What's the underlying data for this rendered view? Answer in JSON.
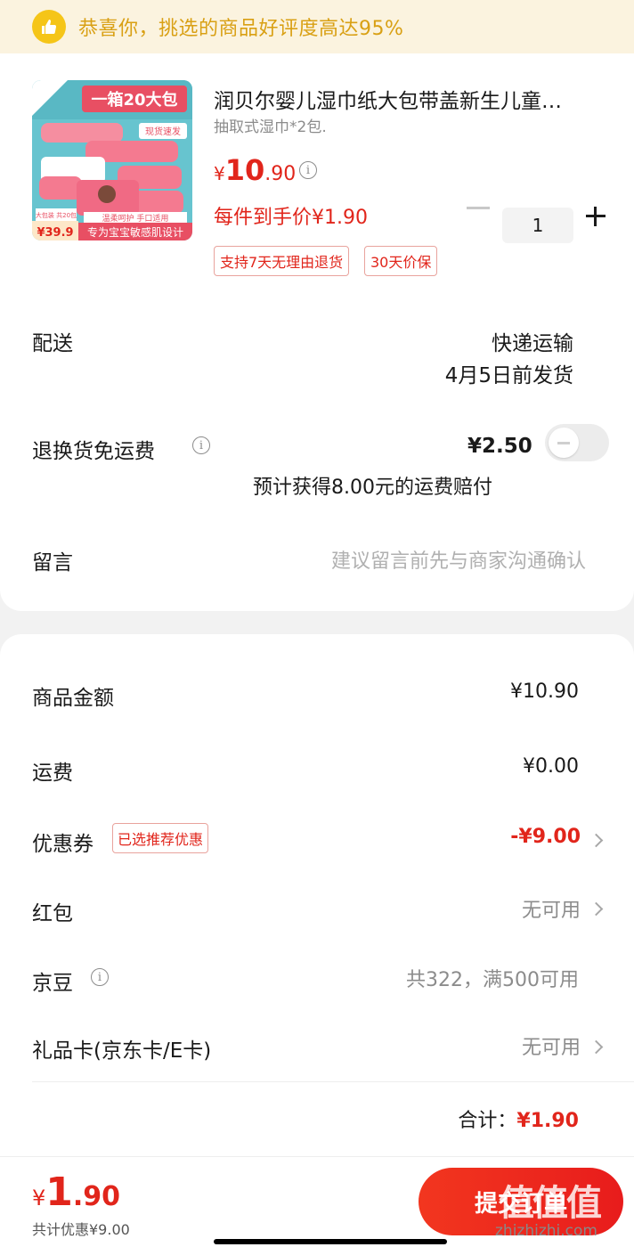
{
  "banner": {
    "text": "恭喜你，挑选的商品好评度高达95%"
  },
  "product": {
    "image": {
      "headline": "一箱20大包",
      "ribbon": "现货速发",
      "feature": "温柔呵护 手口适用",
      "slogan": "专为宝宝敏感肌设计",
      "pack_note": "大包装 共20包",
      "badge_price": "¥39.9"
    },
    "title": "润贝尔婴儿湿巾纸大包带盖新生儿童…",
    "spec": "抽取式湿巾*2包.",
    "price_yen": "¥",
    "price_int": "10",
    "price_dec": ".90",
    "per_price": "每件到手价¥1.90",
    "tags": [
      "支持7天无理由退货",
      "30天价保"
    ],
    "quantity": "1"
  },
  "delivery": {
    "label": "配送",
    "method": "快递运输",
    "eta": "4月5日前发货"
  },
  "return_insurance": {
    "label": "退换货免运费",
    "price": "¥2.50",
    "note": "预计获得8.00元的运费赔付",
    "enabled": false
  },
  "message": {
    "label": "留言",
    "placeholder": "建议留言前先与商家沟通确认"
  },
  "summary": {
    "goods_amount": {
      "label": "商品金额",
      "value": "¥10.90"
    },
    "shipping": {
      "label": "运费",
      "value": "¥0.00"
    },
    "coupon": {
      "label": "优惠券",
      "badge": "已选推荐优惠",
      "value": "-¥9.00"
    },
    "red_packet": {
      "label": "红包",
      "value": "无可用"
    },
    "jd_beans": {
      "label": "京豆",
      "value": "共322，满500可用"
    },
    "gift_card": {
      "label": "礼品卡(京东卡/E卡)",
      "value": "无可用"
    },
    "total_label": "合计：",
    "total_value": "¥1.90"
  },
  "bottom_bar": {
    "price_yen": "¥",
    "price_int": "1",
    "price_dec": ".90",
    "discount": "共计优惠¥9.00",
    "submit_label": "提交订单"
  },
  "watermark": {
    "text": "值值值",
    "url": "zhizhizhi.com"
  },
  "colors": {
    "accent_red": "#e1251b",
    "banner_bg": "#fbf3df",
    "banner_text": "#d9a014",
    "muted": "#8c8c8c"
  }
}
